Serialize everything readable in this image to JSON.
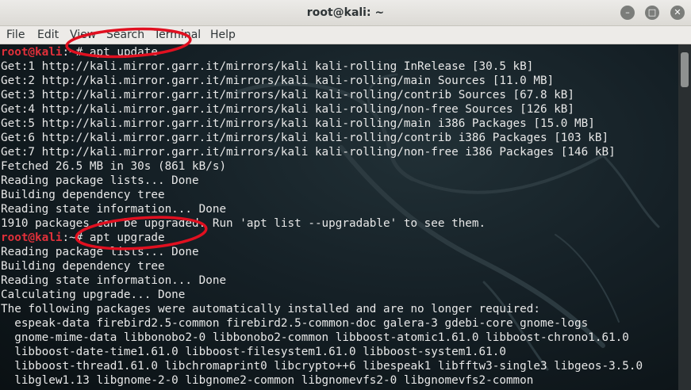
{
  "window": {
    "title": "root@kali: ~"
  },
  "menu": [
    "File",
    "Edit",
    "View",
    "Search",
    "Terminal",
    "Help"
  ],
  "colors": {
    "prompt": "#e0303a",
    "annotation": "#e01020",
    "text": "#e8e8e8"
  },
  "prompt": {
    "user": "root@kali",
    "path_suffix": ":~# "
  },
  "commands": {
    "update": "apt update",
    "upgrade": "apt upgrade"
  },
  "output1": [
    "Get:1 http://kali.mirror.garr.it/mirrors/kali kali-rolling InRelease [30.5 kB]",
    "Get:2 http://kali.mirror.garr.it/mirrors/kali kali-rolling/main Sources [11.0 MB]",
    "Get:3 http://kali.mirror.garr.it/mirrors/kali kali-rolling/contrib Sources [67.8 kB]",
    "Get:4 http://kali.mirror.garr.it/mirrors/kali kali-rolling/non-free Sources [126 kB]",
    "Get:5 http://kali.mirror.garr.it/mirrors/kali kali-rolling/main i386 Packages [15.0 MB]",
    "Get:6 http://kali.mirror.garr.it/mirrors/kali kali-rolling/contrib i386 Packages [103 kB]",
    "Get:7 http://kali.mirror.garr.it/mirrors/kali kali-rolling/non-free i386 Packages [146 kB]",
    "Fetched 26.5 MB in 30s (861 kB/s)",
    "Reading package lists... Done",
    "Building dependency tree",
    "Reading state information... Done",
    "1910 packages can be upgraded. Run 'apt list --upgradable' to see them."
  ],
  "output2": [
    "Reading package lists... Done",
    "Building dependency tree",
    "Reading state information... Done",
    "Calculating upgrade... Done",
    "The following packages were automatically installed and are no longer required:",
    "  espeak-data firebird2.5-common firebird2.5-common-doc galera-3 gdebi-core gnome-logs",
    "  gnome-mime-data libbonobo2-0 libbonobo2-common libboost-atomic1.61.0 libboost-chrono1.61.0",
    "  libboost-date-time1.61.0 libboost-filesystem1.61.0 libboost-system1.61.0",
    "  libboost-thread1.61.0 libchromaprint0 libcrypto++6 libespeak1 libfftw3-single3 libgeos-3.5.0",
    "  libglew1.13 libgnome-2-0 libgnome2-common libgnomevfs2-0 libgnomevfs2-common"
  ]
}
